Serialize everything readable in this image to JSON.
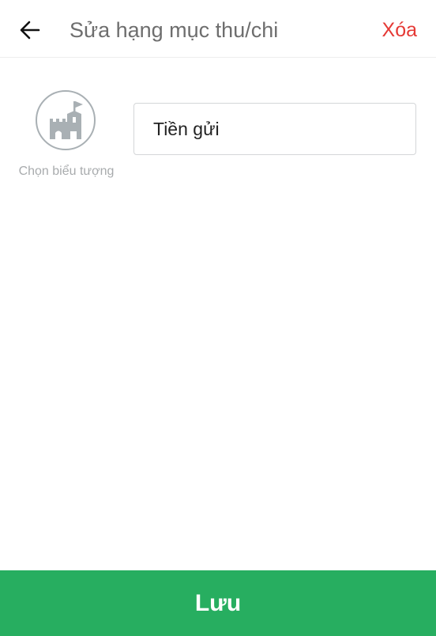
{
  "header": {
    "title": "Sửa hạng mục thu/chi",
    "delete_label": "Xóa",
    "back_icon": "arrow-left-icon"
  },
  "category": {
    "icon": "castle-icon",
    "icon_caption": "Chọn biểu tượng",
    "name_value": "Tiền gửi"
  },
  "footer": {
    "save_label": "Lưu"
  },
  "colors": {
    "accent": "#27ae60",
    "danger": "#e53935",
    "icon_gray": "#a9b0b4"
  }
}
